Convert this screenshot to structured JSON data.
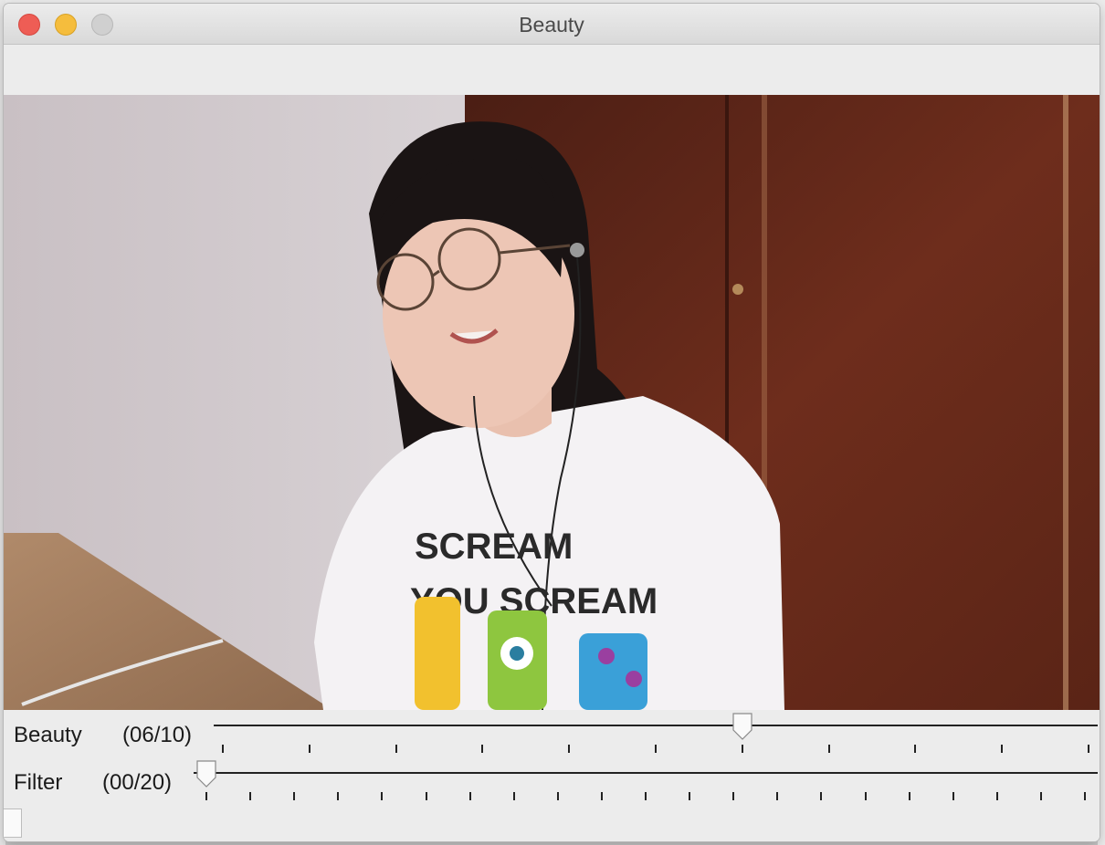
{
  "window": {
    "title": "Beauty"
  },
  "controls": {
    "beauty": {
      "label": "Beauty",
      "value_text": "(06/10)",
      "value": 6,
      "max": 10
    },
    "filter": {
      "label": "Filter",
      "value_text": "(00/20)",
      "value": 0,
      "max": 20
    }
  },
  "video": {
    "shirt_text_line1": "SCREAM",
    "shirt_text_line2": "YOU SCREAM"
  },
  "colors": {
    "close": "#ee5d55",
    "minimize": "#f5bd3d",
    "zoom": "#d0d0d0",
    "wall": "#cfc8cb",
    "wood": "#6a2a1c"
  }
}
